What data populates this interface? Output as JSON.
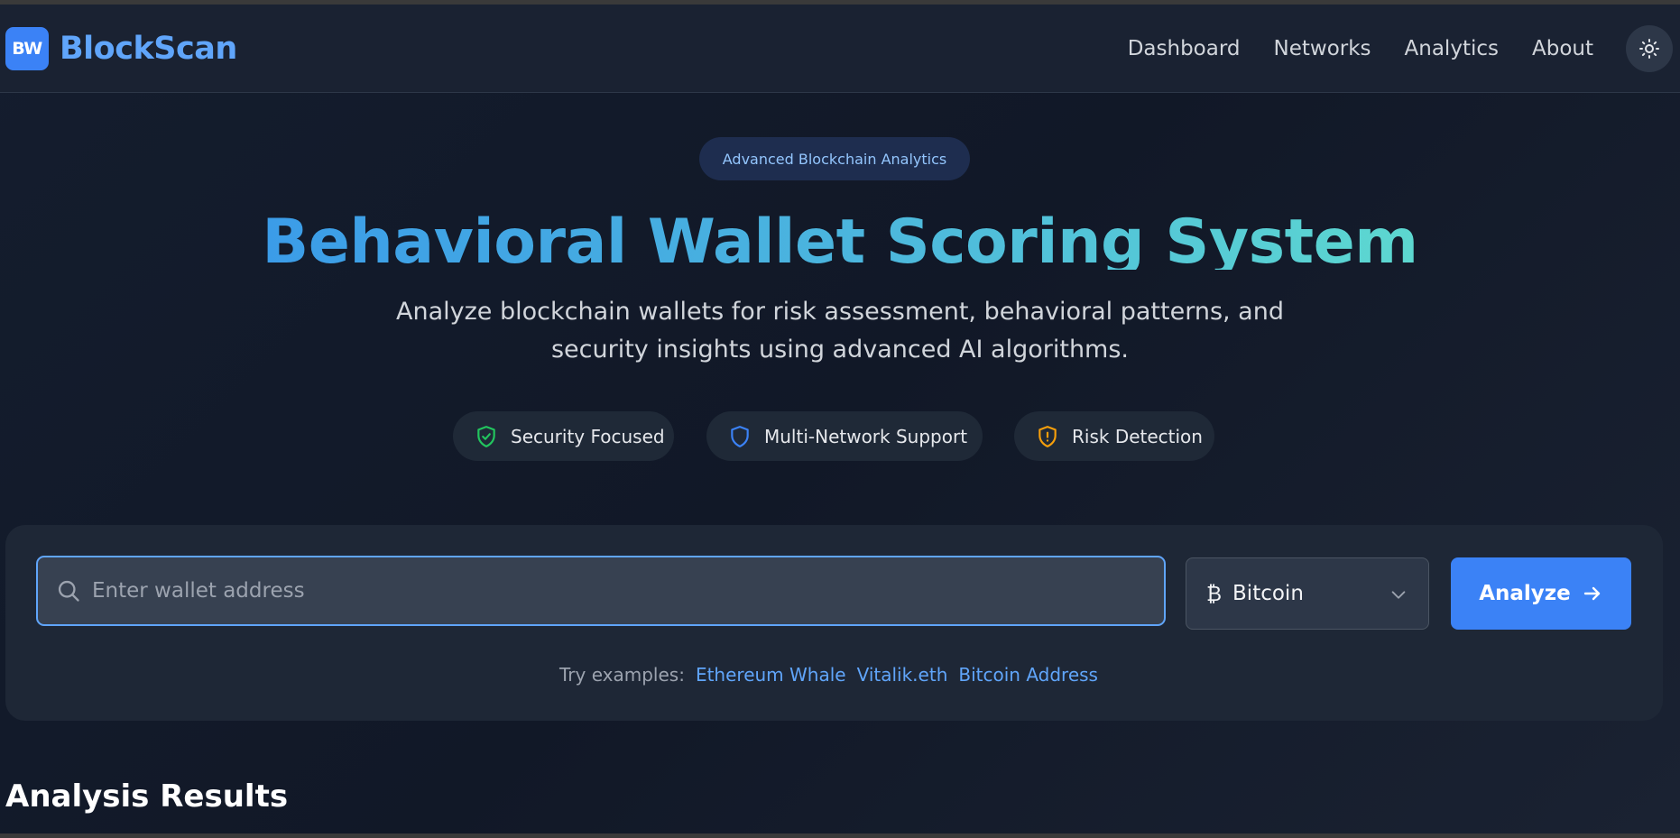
{
  "header": {
    "logo_text": "BW",
    "brand": "BlockScan",
    "nav": [
      "Dashboard",
      "Networks",
      "Analytics",
      "About"
    ],
    "theme_toggle_icon": "sun-icon"
  },
  "hero": {
    "badge": "Advanced Blockchain Analytics",
    "title": "Behavioral Wallet Scoring System",
    "subtitle": "Analyze blockchain wallets for risk assessment, behavioral patterns, and security insights using advanced AI algorithms.",
    "features": [
      {
        "label": "Security Focused",
        "icon": "shield-check-icon",
        "color": "#22c55e"
      },
      {
        "label": "Multi-Network Support",
        "icon": "shield-icon",
        "color": "#3b82f6"
      },
      {
        "label": "Risk Detection",
        "icon": "shield-alert-icon",
        "color": "#f59e0b"
      }
    ]
  },
  "search": {
    "placeholder": "Enter wallet address",
    "value": "",
    "network_symbol": "₿",
    "network": "Bitcoin",
    "analyze_label": "Analyze",
    "examples_label": "Try examples:",
    "examples": [
      "Ethereum Whale",
      "Vitalik.eth",
      "Bitcoin Address"
    ]
  },
  "results": {
    "heading": "Analysis Results"
  },
  "colors": {
    "accent": "#3b82f6",
    "accent_light": "#60a5fa",
    "background": "#111827",
    "card": "#1e2736"
  }
}
